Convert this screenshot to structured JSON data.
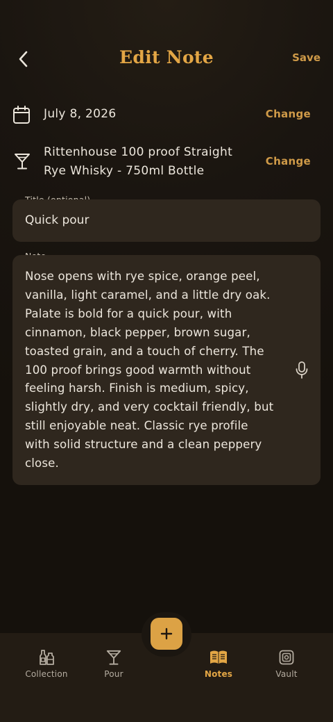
{
  "header": {
    "title": "Edit Note",
    "save_label": "Save"
  },
  "date_row": {
    "value": "July 8, 2026",
    "change_label": "Change"
  },
  "bottle_row": {
    "line1": "Rittenhouse 100 proof Straight",
    "line2": "Rye Whisky - 750ml Bottle",
    "change_label": "Change"
  },
  "title_field": {
    "label": "Title (optional)",
    "value": "Quick pour"
  },
  "note_field": {
    "label": "Note",
    "lines": [
      "Nose opens with rye spice, orange peel,",
      "vanilla, light caramel, and a little dry oak.",
      "Palate is bold for a quick pour, with",
      "cinnamon, black pepper, brown sugar,",
      "toasted grain, and a touch of cherry. The",
      "100 proof brings good warmth without",
      "feeling harsh. Finish is medium, spicy,",
      "slightly dry, and very cocktail friendly, but",
      "still enjoyable neat. Classic rye profile",
      "with solid structure and a clean peppery",
      "close."
    ]
  },
  "fab": {
    "icon": "plus-icon"
  },
  "nav": {
    "items": [
      {
        "label": "Collection",
        "icon": "bottles-icon",
        "active": false
      },
      {
        "label": "Pour",
        "icon": "cocktail-glass-icon",
        "active": false
      },
      {
        "label": "Notes",
        "icon": "open-book-icon",
        "active": true
      },
      {
        "label": "Vault",
        "icon": "vault-icon",
        "active": false
      }
    ]
  },
  "colors": {
    "accent": "#e3a645",
    "accent_button": "#dca245",
    "background": "#1a1510",
    "field_background": "#2f271e",
    "tab_bar": "#231c14"
  }
}
